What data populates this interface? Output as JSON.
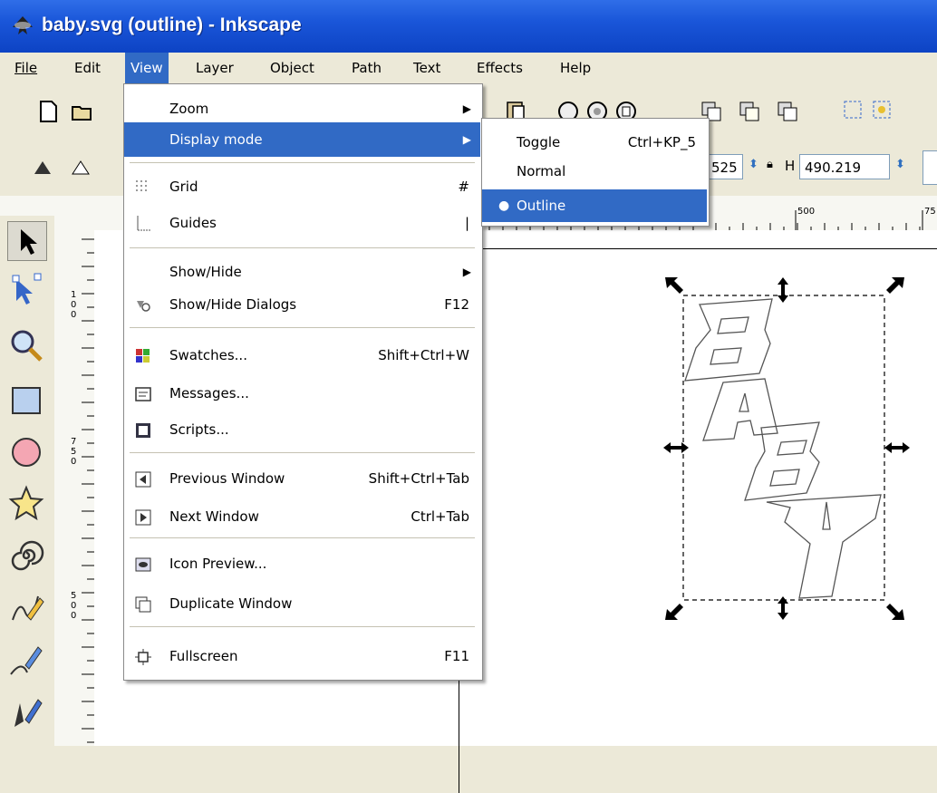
{
  "window": {
    "title": "baby.svg (outline) - Inkscape"
  },
  "menubar": [
    "File",
    "Edit",
    "View",
    "Layer",
    "Object",
    "Path",
    "Text",
    "Effects",
    "Help"
  ],
  "view_menu": {
    "items": [
      {
        "label": "Zoom",
        "shortcut": "",
        "submenu": true
      },
      {
        "label": "Display mode",
        "shortcut": "",
        "submenu": true
      },
      {
        "label": "Grid",
        "shortcut": "#"
      },
      {
        "label": "Guides",
        "shortcut": "|"
      },
      {
        "label": "Show/Hide",
        "shortcut": "",
        "submenu": true
      },
      {
        "label": "Show/Hide Dialogs",
        "shortcut": "F12"
      },
      {
        "label": "Swatches...",
        "shortcut": "Shift+Ctrl+W"
      },
      {
        "label": "Messages...",
        "shortcut": ""
      },
      {
        "label": "Scripts...",
        "shortcut": ""
      },
      {
        "label": "Previous Window",
        "shortcut": "Shift+Ctrl+Tab"
      },
      {
        "label": "Next Window",
        "shortcut": "Ctrl+Tab"
      },
      {
        "label": "Icon Preview...",
        "shortcut": ""
      },
      {
        "label": "Duplicate Window",
        "shortcut": ""
      },
      {
        "label": "Fullscreen",
        "shortcut": "F11"
      }
    ]
  },
  "display_mode_submenu": {
    "items": [
      {
        "label": "Toggle",
        "shortcut": "Ctrl+KP_5"
      },
      {
        "label": "Normal",
        "shortcut": ""
      },
      {
        "label": "Outline",
        "shortcut": "",
        "selected": true
      }
    ]
  },
  "toolbar2": {
    "w_value_partial": "525",
    "h_label": "H",
    "h_value": "490.219"
  },
  "ruler": {
    "h_mark_1": "500",
    "h_mark_2": "75",
    "v_marks": [
      "1",
      "0",
      "0",
      "7",
      "5",
      "0",
      "5",
      "0",
      "0"
    ]
  }
}
